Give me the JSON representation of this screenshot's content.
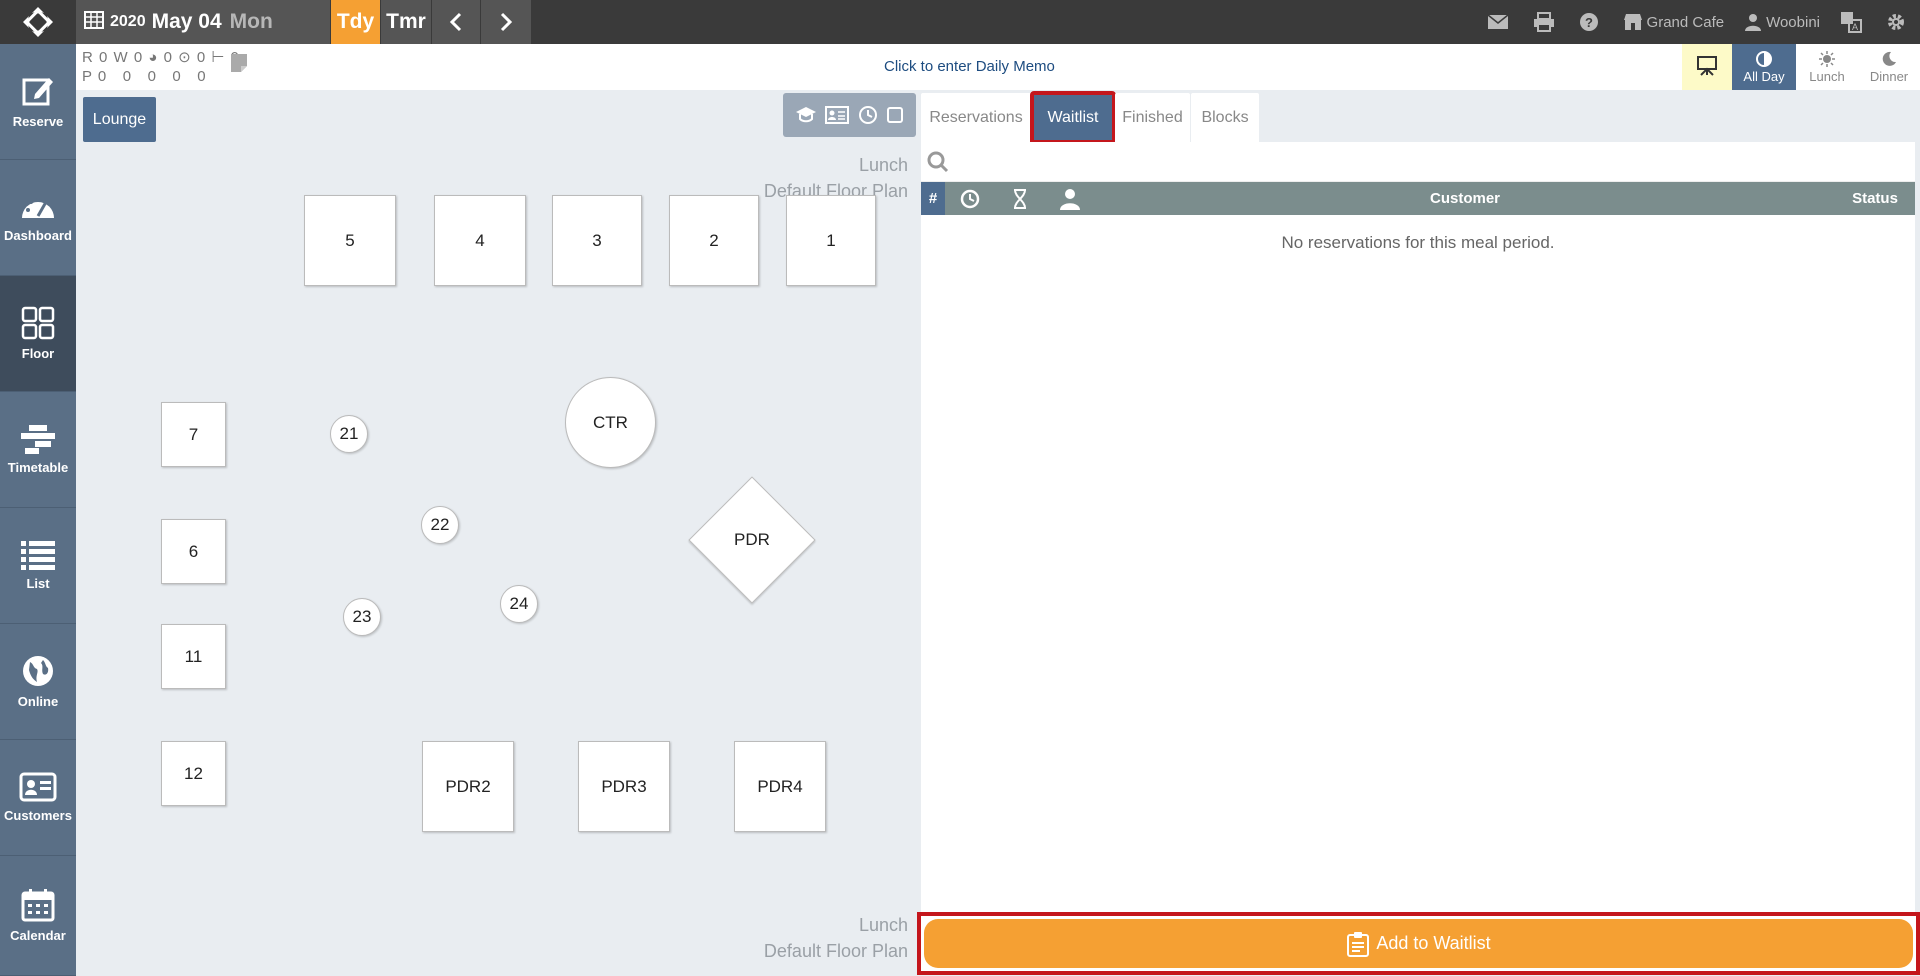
{
  "header": {
    "year": "2020",
    "month_day": "May 04",
    "weekday": "Mon",
    "today_label": "Tdy",
    "tomorrow_label": "Tmr",
    "restaurant": "Grand Cafe",
    "user": "Woobini"
  },
  "sidebar": {
    "items": [
      {
        "label": "Reserve"
      },
      {
        "label": "Dashboard"
      },
      {
        "label": "Floor"
      },
      {
        "label": "Timetable"
      },
      {
        "label": "List"
      },
      {
        "label": "Online"
      },
      {
        "label": "Customers"
      },
      {
        "label": "Calendar"
      }
    ]
  },
  "counts": {
    "row1": "R 0 W 0 ◕ 0 ⊙ 0 ⊢ 0",
    "row2": "P 0   0   0   0   0"
  },
  "memo": "Click to enter Daily Memo",
  "meals": {
    "all_day": "All Day",
    "lunch": "Lunch",
    "dinner": "Dinner"
  },
  "floor": {
    "area": "Lounge",
    "meal": "Lunch",
    "plan": "Default Floor Plan",
    "tables": {
      "t5": "5",
      "t4": "4",
      "t3": "3",
      "t2": "2",
      "t1": "1",
      "t7": "7",
      "t6": "6",
      "t11": "11",
      "t12": "12",
      "t21": "21",
      "t22": "22",
      "t23": "23",
      "t24": "24",
      "ctr": "CTR",
      "pdr": "PDR",
      "pdr2": "PDR2",
      "pdr3": "PDR3",
      "pdr4": "PDR4"
    }
  },
  "panel": {
    "tabs": {
      "reservations": "Reservations",
      "waitlist": "Waitlist",
      "finished": "Finished",
      "blocks": "Blocks"
    },
    "columns": {
      "hash": "#",
      "customer": "Customer",
      "status": "Status"
    },
    "empty_message": "No reservations for this meal period.",
    "add_button": "Add to Waitlist"
  },
  "colors": {
    "accent_orange": "#f5a033",
    "nav_blue": "#4e6c8f",
    "sidebar": "#5a6f86",
    "highlight_red": "#c4161c"
  }
}
